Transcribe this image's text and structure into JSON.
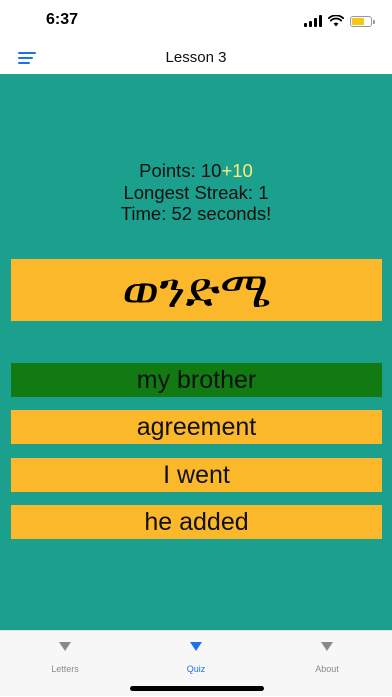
{
  "status_bar": {
    "time": "6:37"
  },
  "nav": {
    "title": "Lesson 3"
  },
  "stats": {
    "points_label": "Points: 10",
    "points_bonus": "+10",
    "streak": "Longest Streak: 1",
    "time": "Time: 52 seconds!"
  },
  "prompt": {
    "text": "ወንድሜ"
  },
  "answers": [
    {
      "label": "my brother",
      "state": "correct"
    },
    {
      "label": "agreement",
      "state": "default"
    },
    {
      "label": "I went",
      "state": "default"
    },
    {
      "label": "he added",
      "state": "default"
    }
  ],
  "tabs": [
    {
      "label": "Letters",
      "icon": "triangle-down-icon"
    },
    {
      "label": "Quiz",
      "icon": "triangle-down-icon",
      "active": true
    },
    {
      "label": "About",
      "icon": "triangle-down-icon"
    }
  ],
  "colors": {
    "background": "#1aa08c",
    "card": "#fab82a",
    "correct": "#117a12",
    "accent": "#1a73e8"
  }
}
